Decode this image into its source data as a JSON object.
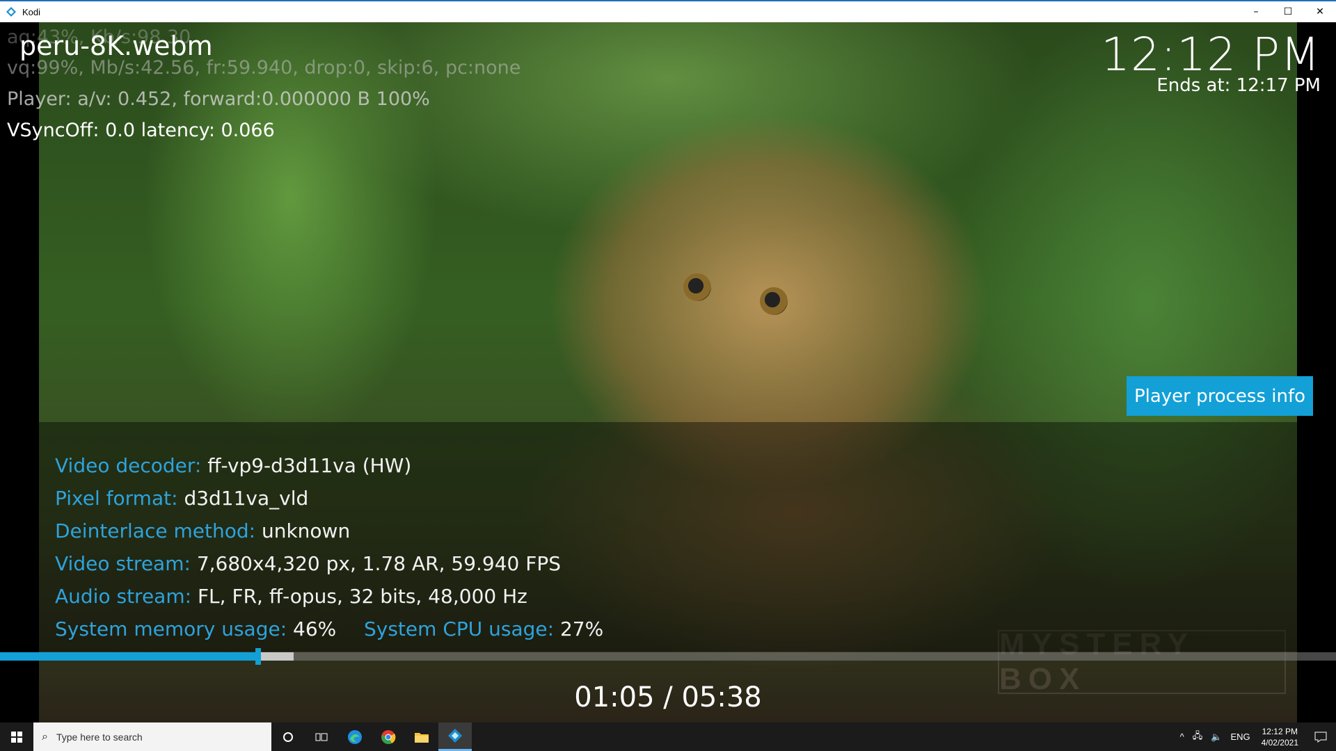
{
  "window": {
    "title": "Kodi",
    "minimize_glyph": "–",
    "maximize_glyph": "☐",
    "close_glyph": "✕"
  },
  "osd": {
    "filename": "peru-8K.webm",
    "clock": "12:12 PM",
    "ends_at": "Ends at: 12:17 PM",
    "badge": "Player process info",
    "timecode": "01:05 / 05:38",
    "progress_played_fraction": 0.193,
    "progress_buffer_fraction": 0.22
  },
  "debug": {
    "line1": "aq:43%, Kb/s:98.30",
    "line2": "vq:99%, Mb/s:42.56, fr:59.940, drop:0, skip:6, pc:none",
    "line3": "Player: a/v: 0.452,  forward:0.000000 B 100%",
    "line4": "VSyncOff: 0.0 latency: 0.066"
  },
  "info": {
    "video_decoder_label": "Video decoder:",
    "video_decoder_value": "ff-vp9-d3d11va (HW)",
    "pixel_format_label": "Pixel format:",
    "pixel_format_value": "d3d11va_vld",
    "deinterlace_label": "Deinterlace method:",
    "deinterlace_value": "unknown",
    "video_stream_label": "Video stream:",
    "video_stream_value": "7,680x4,320 px, 1.78 AR, 59.940 FPS",
    "audio_stream_label": "Audio stream:",
    "audio_stream_value": "FL, FR, ff-opus, 32 bits, 48,000 Hz",
    "memory_label": "System memory usage:",
    "memory_value": "46%",
    "cpu_label": "System CPU usage:",
    "cpu_value": "27%"
  },
  "watermark": "MYSTERY BOX",
  "taskbar": {
    "search_placeholder": "Type here to search",
    "language": "ENG",
    "time": "12:12 PM",
    "date": "4/02/2021"
  },
  "colors": {
    "accent": "#12a0d7",
    "label": "#2ea3dc"
  }
}
